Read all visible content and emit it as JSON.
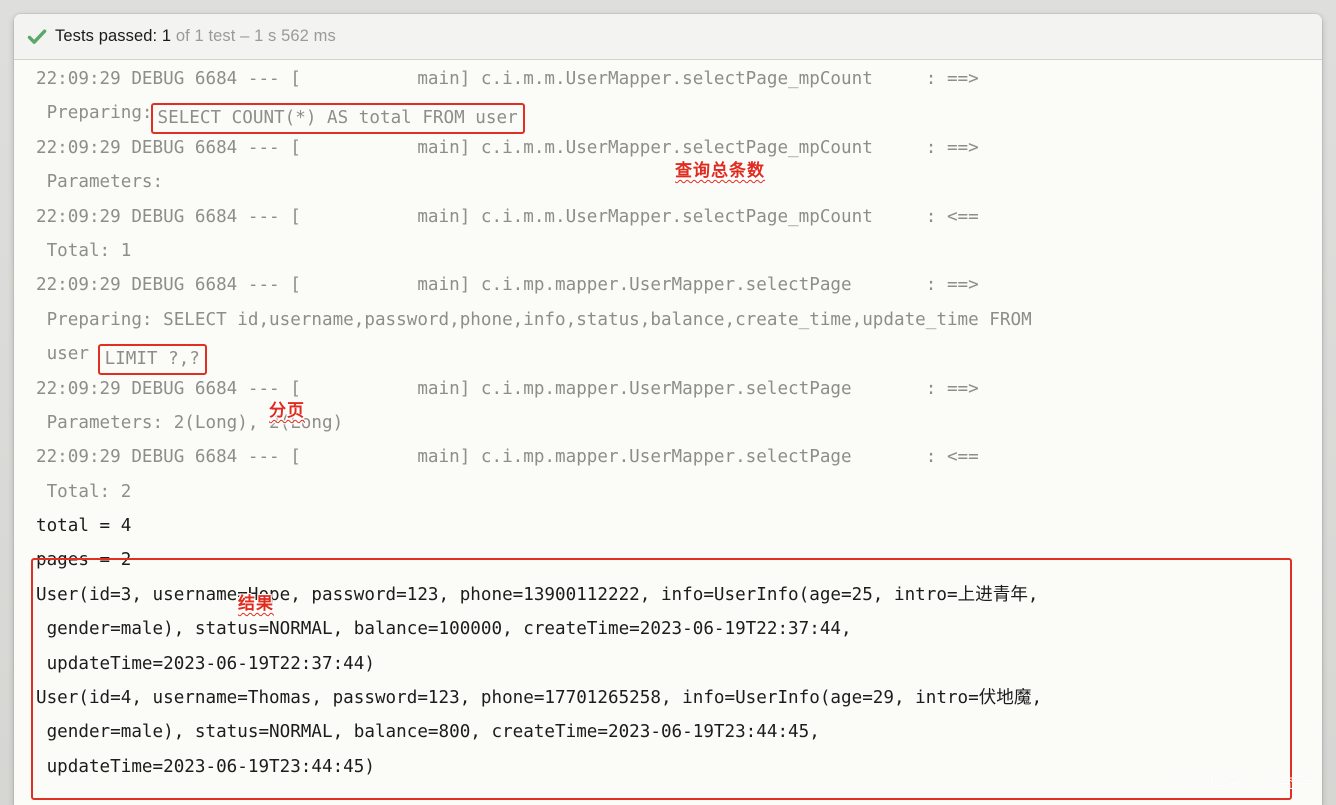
{
  "status_bar": {
    "icon": "check-mark-icon",
    "prefix": "Tests passed: ",
    "count": "1",
    "suffix": " of 1 test – 1 s 562 ms",
    "full_text": "Tests passed: 1 of 1 test – 1 s 562 ms",
    "accent_color": "#59a869"
  },
  "console": {
    "text_color": "#8d8d89",
    "result_text_color": "#1c1c1c",
    "highlight_color": "#e03024",
    "lines": [
      {
        "kind": "log",
        "text": "22:09:29 DEBUG 6684 --- [           main] c.i.m.m.UserMapper.selectPage_mpCount     : ==>"
      },
      {
        "kind": "boxed",
        "before": " Preparing:",
        "boxed": "SELECT COUNT(*) AS total FROM user",
        "after": ""
      },
      {
        "kind": "log",
        "text": "22:09:29 DEBUG 6684 --- [           main] c.i.m.m.UserMapper.selectPage_mpCount     : ==>"
      },
      {
        "kind": "log",
        "text": " Parameters:"
      },
      {
        "kind": "log",
        "text": "22:09:29 DEBUG 6684 --- [           main] c.i.m.m.UserMapper.selectPage_mpCount     : <=="
      },
      {
        "kind": "log",
        "text": " Total: 1"
      },
      {
        "kind": "log",
        "text": "22:09:29 DEBUG 6684 --- [           main] c.i.mp.mapper.UserMapper.selectPage       : ==>"
      },
      {
        "kind": "log",
        "text": " Preparing: SELECT id,username,password,phone,info,status,balance,create_time,update_time FROM"
      },
      {
        "kind": "boxed",
        "before": " user ",
        "boxed": "LIMIT ?,?",
        "after": ""
      },
      {
        "kind": "log",
        "text": "22:09:29 DEBUG 6684 --- [           main] c.i.mp.mapper.UserMapper.selectPage       : ==>"
      },
      {
        "kind": "log",
        "text": " Parameters: 2(Long), 2(Long)"
      },
      {
        "kind": "log",
        "text": "22:09:29 DEBUG 6684 --- [           main] c.i.mp.mapper.UserMapper.selectPage       : <=="
      },
      {
        "kind": "log",
        "text": " Total: 2"
      },
      {
        "kind": "result",
        "text": "total = 4"
      },
      {
        "kind": "result",
        "text": "pages = 2"
      },
      {
        "kind": "result",
        "text": "User(id=3, username=Hope, password=123, phone=13900112222, info=UserInfo(age=25, intro=上进青年,"
      },
      {
        "kind": "result",
        "text": " gender=male), status=NORMAL, balance=100000, createTime=2023-06-19T22:37:44,"
      },
      {
        "kind": "result",
        "text": " updateTime=2023-06-19T22:37:44)"
      },
      {
        "kind": "result",
        "text": "User(id=4, username=Thomas, password=123, phone=17701265258, info=UserInfo(age=29, intro=伏地魔,"
      },
      {
        "kind": "result",
        "text": " gender=male), status=NORMAL, balance=800, createTime=2023-06-19T23:44:45,"
      },
      {
        "kind": "result",
        "text": " updateTime=2023-06-19T23:44:45)"
      }
    ]
  },
  "annotations": {
    "count_query": "查询总条数",
    "pagination": "分页",
    "result": "结果"
  },
  "watermark": "黑马程序员-研究院"
}
